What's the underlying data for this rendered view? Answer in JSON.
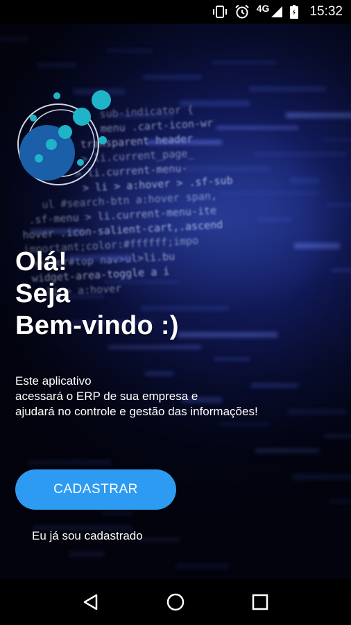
{
  "status_bar": {
    "network": "4G",
    "time": "15:32",
    "icons": [
      "vibrate-icon",
      "alarm-icon",
      "signal-icon",
      "battery-icon"
    ]
  },
  "background": {
    "code_lines": [
      "sub-indicator {",
      "menu .cart-icon-wr",
      "transparent header",
      "> li.current_page_",
      "> li.current-menu-",
      "> li > a:hover > .sf-sub",
      "ul #search-btn a:hover span,",
      ".sf-menu > li.current-menu-ite",
      "hover .icon-salient-cart,.ascend",
      "important;color:#ffffff;impo",
      "header#top nav>ul>li.bu",
      "widget-area-toggle a i",
      "li > a:hover"
    ]
  },
  "greeting": {
    "line1": "Olá!",
    "line2": "Seja",
    "line3": "Bem-vindo :)"
  },
  "description": {
    "line1": "Este aplicativo",
    "line2": "acessará o ERP de sua empresa e",
    "line3": "ajudará no controle e gestão das informações!"
  },
  "actions": {
    "signup_label": "CADASTRAR",
    "login_label": "Eu já sou cadastrado"
  },
  "colors": {
    "accent": "#2e9bf2",
    "logo_dark": "#1a5fa8",
    "logo_light": "#1fb4c8"
  }
}
